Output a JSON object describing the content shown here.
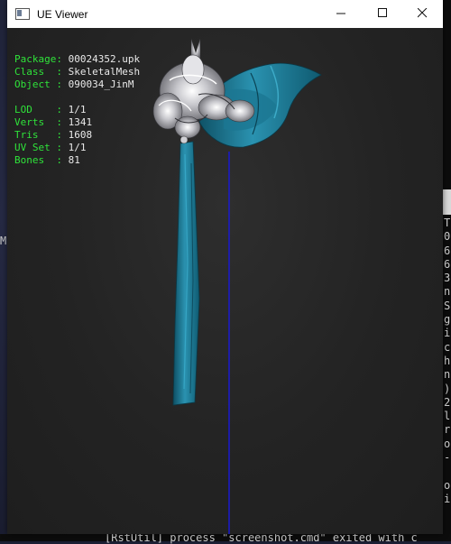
{
  "window": {
    "title": "UE Viewer",
    "controls": {
      "minimize": "—",
      "maximize": "☐",
      "close": "✕"
    }
  },
  "info": {
    "package_label": "Package: ",
    "package_value": "00024352.upk",
    "class_label": "Class  : ",
    "class_value": "SkeletalMesh",
    "object_label": "Object : ",
    "object_value": "090034_JinM",
    "lod_label": "LOD    : ",
    "lod_value": "1/1",
    "verts_label": "Verts  : ",
    "verts_value": "1341",
    "tris_label": "Tris   : ",
    "tris_value": "1608",
    "uvset_label": "UV Set : ",
    "uvset_value": "1/1",
    "bones_label": "Bones  : ",
    "bones_value": "81"
  },
  "background": {
    "left_fragment": "M",
    "right_fragment": "T\n0\n6\n6\n3\nn\nS\ng\ni\nc\nh\nn\n)\n2\nl\nr\no\n-\n\no\ni",
    "bottom_fragment": "[RstUtil] process \"screenshot.cmd\" exited with c"
  },
  "colors": {
    "info_label": "#2fe33a",
    "info_value": "#e9e9e9",
    "viewport_bg": "#232323",
    "mesh_teal": "#1f7f9c",
    "axis_blue": "#1a1ad0"
  },
  "viewport": {
    "model": "SkeletalMesh 090034_JinM"
  }
}
